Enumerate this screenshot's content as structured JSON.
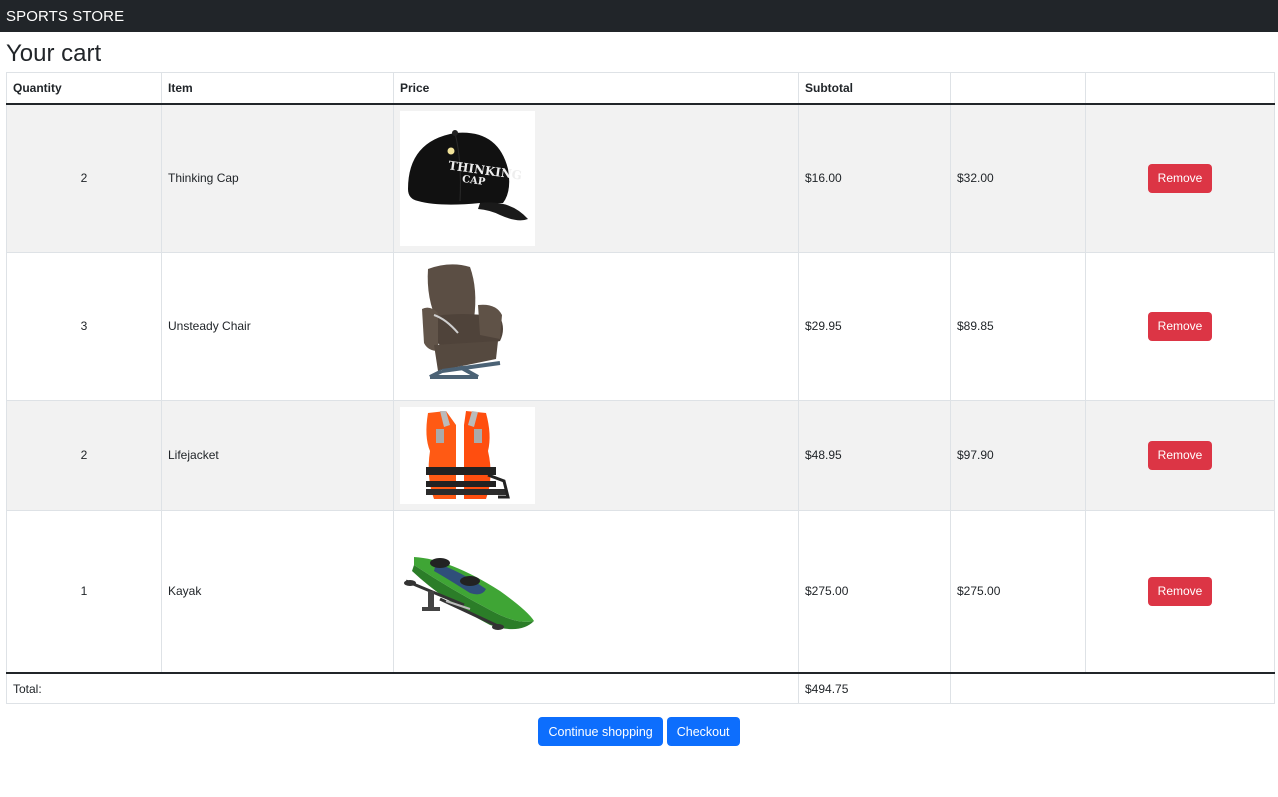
{
  "navbar": {
    "brand": "SPORTS STORE"
  },
  "page": {
    "title": "Your cart"
  },
  "table": {
    "headers": [
      "Quantity",
      "Item",
      "Price",
      "Subtotal",
      "",
      ""
    ],
    "rows": [
      {
        "quantity": "2",
        "item": "Thinking Cap",
        "image": "cap-image",
        "price": "$16.00",
        "subtotal": "$32.00",
        "action": "Remove"
      },
      {
        "quantity": "3",
        "item": "Unsteady Chair",
        "image": "chair-image",
        "price": "$29.95",
        "subtotal": "$89.85",
        "action": "Remove"
      },
      {
        "quantity": "2",
        "item": "Lifejacket",
        "image": "lifejacket-image",
        "price": "$48.95",
        "subtotal": "$97.90",
        "action": "Remove"
      },
      {
        "quantity": "1",
        "item": "Kayak",
        "image": "kayak-image",
        "price": "$275.00",
        "subtotal": "$275.00",
        "action": "Remove"
      }
    ],
    "footer": {
      "label": "Total:",
      "total": "$494.75"
    }
  },
  "buttons": {
    "continue": "Continue shopping",
    "checkout": "Checkout"
  },
  "colors": {
    "navbar": "#212529",
    "danger": "#dc3545",
    "primary": "#0d6efd",
    "stripe": "#f2f2f2"
  }
}
